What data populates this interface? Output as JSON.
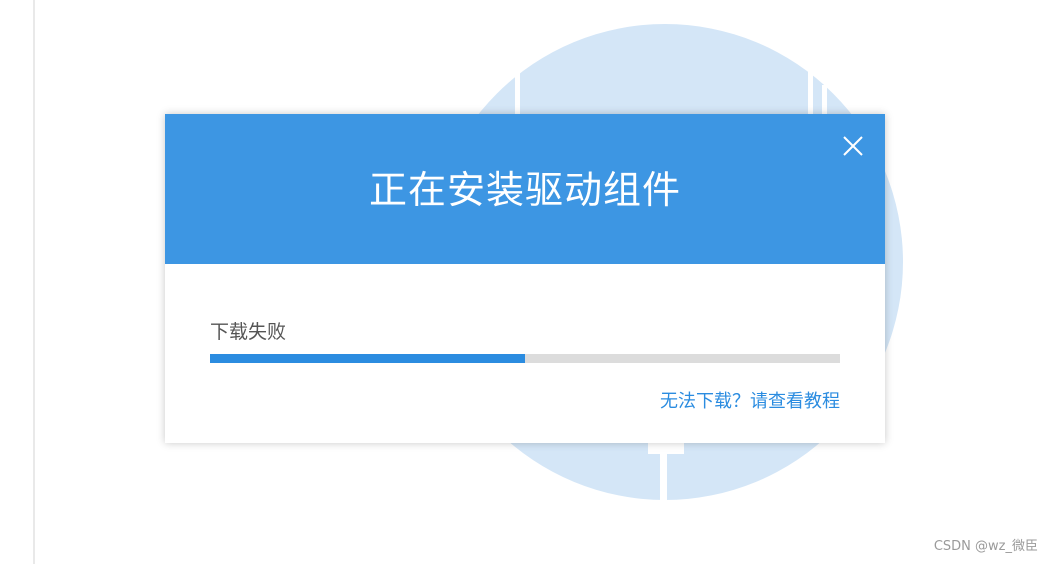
{
  "dialog": {
    "title": "正在安装驱动组件",
    "status": "下载失败",
    "progress": 0.5,
    "help_link": "无法下载？请查看教程",
    "close_icon": "close-icon"
  },
  "watermark": "CSDN @wz_微臣",
  "colors": {
    "header": "#3d96e3",
    "progress_fill": "#2b8ce0",
    "progress_track": "#dcdcdc",
    "link": "#2b8ce0",
    "background_circle": "#d4e6f7"
  }
}
